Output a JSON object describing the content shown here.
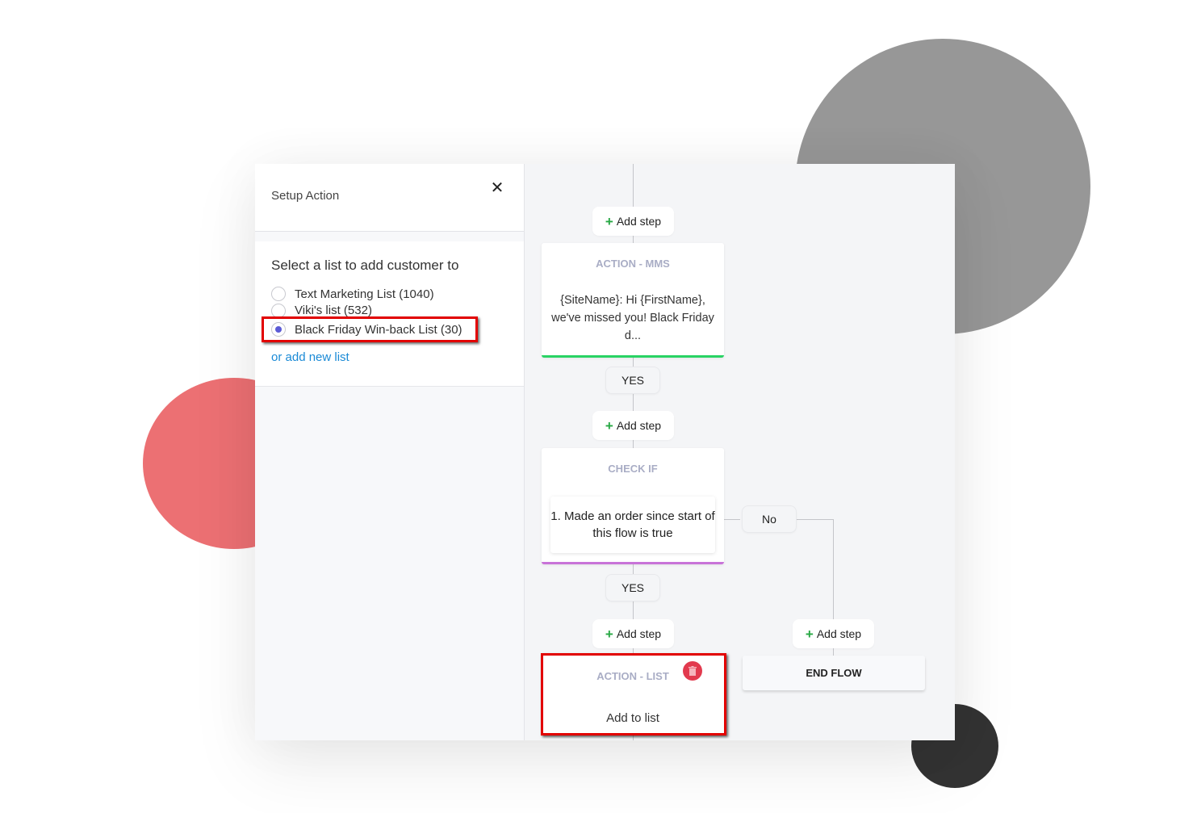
{
  "panel": {
    "title": "Setup Action",
    "close_icon": "close-icon",
    "heading": "Select a list to add customer to",
    "lists": [
      {
        "label": "Text Marketing List (1040)",
        "selected": false
      },
      {
        "label": "Viki's list (532)",
        "selected": false
      },
      {
        "label": "Black Friday Win-back List (30)",
        "selected": true
      }
    ],
    "add_new_link": "or add new list"
  },
  "flow": {
    "add_step_label": "Add step",
    "add_step_icon": "plus-icon",
    "yes_label": "YES",
    "no_label": "No",
    "nodes": {
      "mms": {
        "title": "ACTION - MMS",
        "body": "{SiteName}: Hi {FirstName}, we've missed you! Black Friday d...",
        "accent": "#29d364"
      },
      "check": {
        "title": "CHECK IF",
        "condition": "1. Made an order since start of this flow is true",
        "accent": "#c873d8"
      },
      "list": {
        "title": "ACTION - LIST",
        "body": "Add to list",
        "delete_icon": "trash-icon"
      },
      "end": {
        "title": "END FLOW"
      }
    }
  },
  "colors": {
    "highlight": "#e20000",
    "radio_selected": "#5b5bd6",
    "link": "#1a8ad6",
    "add_step_plus": "#27a844",
    "delete": "#e23a4e"
  }
}
